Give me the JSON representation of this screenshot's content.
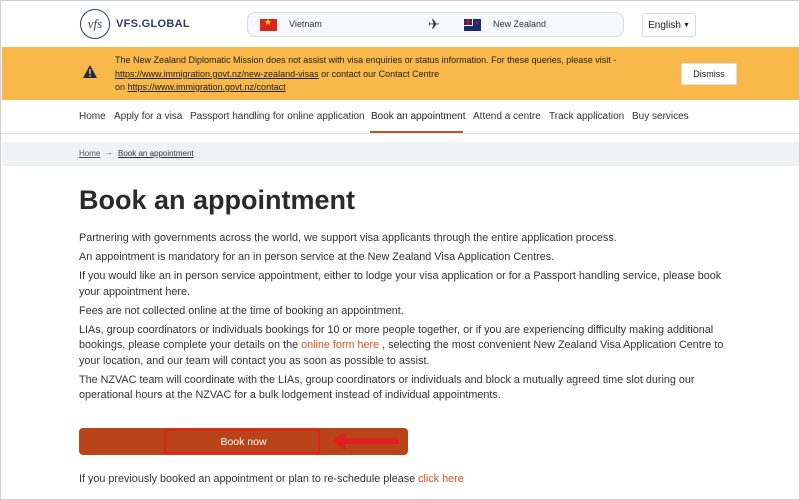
{
  "header": {
    "logo_mark": "vfs",
    "logo_text": "VFS.GLOBAL",
    "route_from": "Vietnam",
    "route_to": "New Zealand",
    "language": "English"
  },
  "notice": {
    "text_1": "The New Zealand Diplomatic Mission does not assist with visa enquiries or status information. For these queries, please visit -",
    "link_1": "https://www.immigration.govt.nz/new-zealand-visas",
    "text_2": " or contact our Contact Centre",
    "text_3": "on ",
    "link_2": "https://www.immigration.govt.nz/contact",
    "dismiss_label": "Dismiss"
  },
  "nav": {
    "items": [
      {
        "label": "Home"
      },
      {
        "label": "Apply for a visa"
      },
      {
        "label": "Passport handling for online application"
      },
      {
        "label": "Book an appointment"
      },
      {
        "label": "Attend a centre"
      },
      {
        "label": "Track application"
      },
      {
        "label": "Buy services"
      }
    ]
  },
  "breadcrumb": {
    "home": "Home",
    "separator": "→",
    "current": "Book an appointment"
  },
  "main": {
    "title": "Book an appointment",
    "p1": "Partnering with governments across the world, we support visa applicants through the entire application process.",
    "p2": "An appointment is mandatory for an in person service at the New Zealand Visa Application Centres.",
    "p3": "If you would like an in person service appointment, either to lodge your visa application or for a Passport handling service, please book your appointment here.",
    "p4": "Fees are not collected online at the time of booking an appointment.",
    "p5_a": "LIAs, group coordinators or individuals bookings for 10 or more people together, or if you are experiencing difficulty making additional bookings, please complete your details on the ",
    "p5_link": "online form here",
    "p5_b": " , selecting the most convenient New Zealand Visa Application Centre to your location, and our team will contact you as soon as possible to assist.",
    "p6": "The NZVAC team will coordinate with the LIAs, group coordinators or individuals and block a mutually agreed time slot during our operational hours at the NZVAC for a bulk lodgement instead of individual appointments.",
    "book_button": "Book now",
    "footer_text": "If you previously booked an appointment or plan to re-schedule please ",
    "footer_link": "click here"
  },
  "colors": {
    "notice_bg": "#f8b84a",
    "accent": "#b9441a",
    "link": "#d9531e",
    "annotation_red": "#e01f1f"
  }
}
